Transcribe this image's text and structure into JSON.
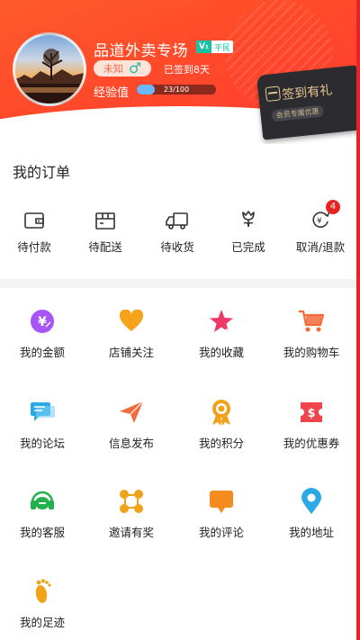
{
  "header": {
    "shop_name": "品道外卖专场",
    "vip_prefix": "V₁",
    "vip_label": "平民",
    "gender_text": "未知",
    "gender_symbol": "♂",
    "signed_text": "已签到8天",
    "exp_label": "经验值",
    "exp_value": "23/100",
    "exp_progress": 0.23,
    "signin_title": "签到有礼",
    "signin_sub": "会员专属优惠"
  },
  "orders": {
    "title": "我的订单",
    "items": [
      {
        "label": "待付款",
        "icon": "wallet-icon"
      },
      {
        "label": "待配送",
        "icon": "box-icon"
      },
      {
        "label": "待收货",
        "icon": "truck-icon"
      },
      {
        "label": "已完成",
        "icon": "flower-icon"
      },
      {
        "label": "取消/退款",
        "icon": "refund-icon",
        "badge": "4"
      }
    ]
  },
  "grid": [
    {
      "label": "我的金额",
      "icon": "money-icon",
      "color": "#a855f7"
    },
    {
      "label": "店铺关注",
      "icon": "heart-icon",
      "color": "#f6a21a"
    },
    {
      "label": "我的收藏",
      "icon": "star-icon",
      "color": "#ee3a6b"
    },
    {
      "label": "我的购物车",
      "icon": "cart-icon",
      "color": "#f26b3a"
    },
    {
      "label": "我的论坛",
      "icon": "chat-icon",
      "color": "#2aa9e6"
    },
    {
      "label": "信息发布",
      "icon": "send-icon",
      "color": "#f26b3a"
    },
    {
      "label": "我的积分",
      "icon": "medal-icon",
      "color": "#f0a21a"
    },
    {
      "label": "我的优惠券",
      "icon": "coupon-icon",
      "color": "#f0454a"
    },
    {
      "label": "我的客服",
      "icon": "headset-icon",
      "color": "#22b14c"
    },
    {
      "label": "邀请有奖",
      "icon": "network-icon",
      "color": "#f0a21a"
    },
    {
      "label": "我的评论",
      "icon": "comment-icon",
      "color": "#f58a1f"
    },
    {
      "label": "我的地址",
      "icon": "location-icon",
      "color": "#2aa9e6"
    },
    {
      "label": "我的足迹",
      "icon": "footprint-icon",
      "color": "#f0a21a"
    }
  ]
}
